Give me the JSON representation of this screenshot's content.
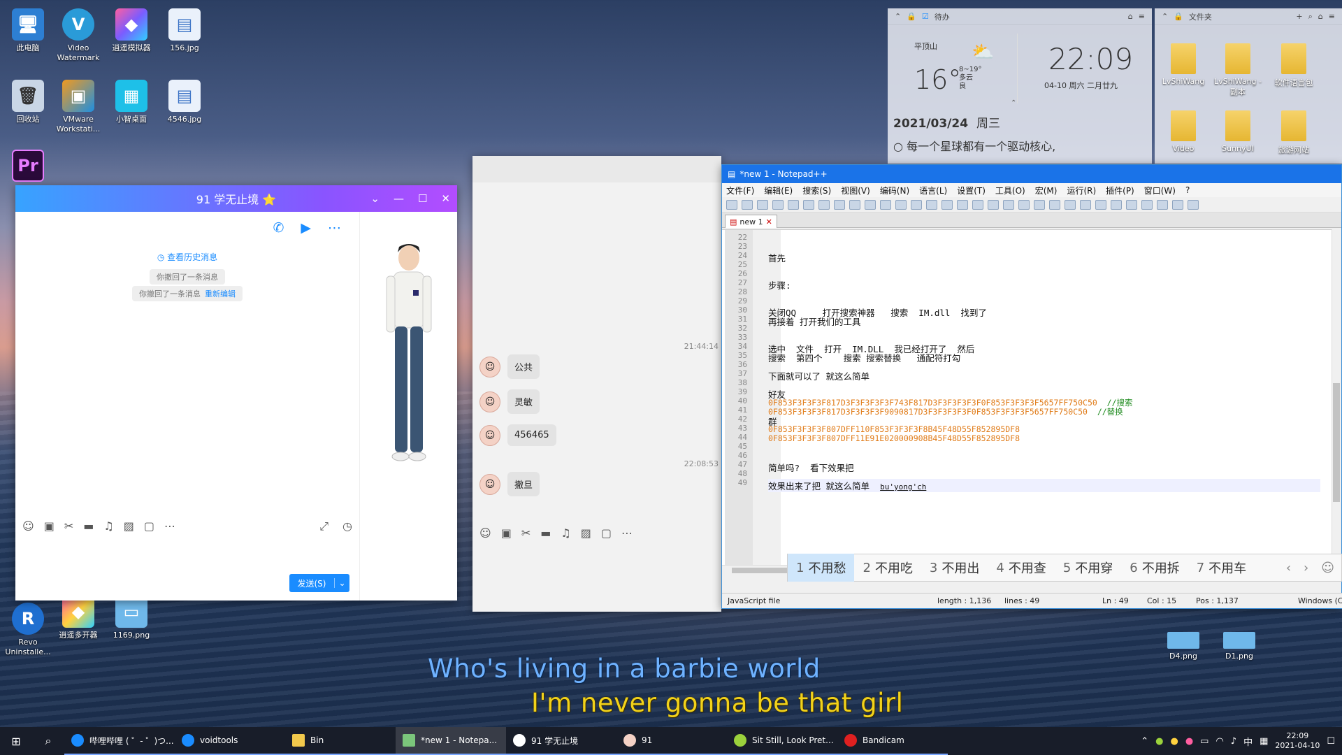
{
  "desktop": {
    "icons": [
      {
        "label": "此电脑",
        "glyph": "🖥"
      },
      {
        "label": "Video Watermark",
        "glyph": "V"
      },
      {
        "label": "逍遥模拟器",
        "glyph": "◆"
      },
      {
        "label": "156.jpg",
        "glyph": "▤"
      },
      {
        "label": "回收站",
        "glyph": "🗑"
      },
      {
        "label": "VMware Workstati...",
        "glyph": "▣"
      },
      {
        "label": "小智桌面",
        "glyph": "▦"
      },
      {
        "label": "4546.jpg",
        "glyph": "▤"
      },
      {
        "label": "Pr",
        "glyph": "Pr"
      },
      {
        "label": "Revo Uninstalle...",
        "glyph": "R"
      },
      {
        "label": "逍遥多开器",
        "glyph": "◆"
      },
      {
        "label": "1169.png",
        "glyph": "▭"
      }
    ],
    "lyrics": {
      "line1": "Who's living in a barbie world",
      "line2": "I'm never gonna be that girl"
    }
  },
  "widgets": {
    "todo": {
      "title": "待办"
    },
    "weather": {
      "location": "平顶山",
      "temp": "16°",
      "range": "8~19°",
      "condition": "多云",
      "aqi": "良"
    },
    "clock": {
      "time": "22:09",
      "date": "04-10 周六  二月廿九"
    },
    "quote": {
      "date": "2021/03/24",
      "weekday": "周三",
      "text": "每一个星球都有一个驱动核心,"
    },
    "files": {
      "title": "文件夹",
      "items": [
        "LvShiWang",
        "LvShiWang - 副本",
        "软件语言包",
        "Video",
        "SunnyUI",
        "旅游网站"
      ]
    },
    "desktop_files": [
      "D4.png",
      "D1.png"
    ]
  },
  "qq": {
    "title": "91 学无止境 ⭐",
    "history_link": "查看历史消息",
    "recall1": "你撤回了一条消息",
    "recall2": "你撤回了一条消息",
    "re_edit": "重新编辑",
    "send": "发送(S)"
  },
  "chat2": {
    "messages": [
      {
        "time": "21:44:14",
        "text": "公共"
      },
      {
        "text": "灵敏"
      },
      {
        "text": "456465"
      },
      {
        "time": "22:08:53",
        "text": "撤旦"
      }
    ]
  },
  "npp": {
    "title": "*new 1 - Notepad++",
    "menu": [
      "文件(F)",
      "编辑(E)",
      "搜索(S)",
      "视图(V)",
      "编码(N)",
      "语言(L)",
      "设置(T)",
      "工具(O)",
      "宏(M)",
      "运行(R)",
      "插件(P)",
      "窗口(W)",
      "?"
    ],
    "tab": "new 1",
    "line_numbers": [
      "22",
      "23",
      "24",
      "25",
      "26",
      "27",
      "28",
      "29",
      "30",
      "31",
      "32",
      "33",
      "34",
      "35",
      "36",
      "37",
      "38",
      "39",
      "40",
      "41",
      "42",
      "43",
      "44",
      "45",
      "46",
      "47",
      "48",
      "49"
    ],
    "lines": {
      "l24": "首先",
      "l27": "步骤:",
      "l30": "关闭QQ     打开搜索神器   搜索  IM.dll  找到了",
      "l31": "再接着 打开我们的工具",
      "l34": "选中  文件  打开  IM.DLL  我已经打开了  然后",
      "l35": "搜索  第四个    搜索 搜索替换   通配符打勾",
      "l37": "下面就可以了 就这么简单",
      "l39": "好友",
      "l40": "0F853F3F3F3F817D3F3F3F3F3F743F817D3F3F3F3F3F0F853F3F3F3F5657FF750C50",
      "l40c": "//搜索",
      "l41": "0F853F3F3F3F817D3F3F3F3F9090817D3F3F3F3F3F0F853F3F3F3F5657FF750C50",
      "l41c": "//替换",
      "l42": "群",
      "l43": "0F853F3F3F3F807DFF110F853F3F3F3F8B45F48D55F852895DF8",
      "l44": "0F853F3F3F3F807DFF11E91E020000908B45F48D55F852895DF8",
      "l47": "简单吗?  看下效果把",
      "l49": "效果出来了把 就这么简单",
      "l49ime": "bu'yong'ch"
    },
    "status": {
      "lang": "JavaScript file",
      "length": "length : 1,136",
      "lines": "lines : 49",
      "ln": "Ln : 49",
      "col": "Col : 15",
      "pos": "Pos : 1,137",
      "eol": "Windows (CR"
    }
  },
  "ime": {
    "candidates": [
      {
        "n": "1",
        "w": "不用愁"
      },
      {
        "n": "2",
        "w": "不用吃"
      },
      {
        "n": "3",
        "w": "不用出"
      },
      {
        "n": "4",
        "w": "不用查"
      },
      {
        "n": "5",
        "w": "不用穿"
      },
      {
        "n": "6",
        "w": "不用拆"
      },
      {
        "n": "7",
        "w": "不用车"
      }
    ]
  },
  "taskbar": {
    "items": [
      {
        "label": "哔哩哔哩 ( ゜- ゜)つ...",
        "color": "#1a8cff"
      },
      {
        "label": "voidtools",
        "color": "#1a8cff"
      },
      {
        "label": "Bin",
        "color": "#f2c94c"
      },
      {
        "label": "*new 1 - Notepa...",
        "color": "#7bc67b"
      },
      {
        "label": "91 学无止境",
        "color": "#ffffff"
      },
      {
        "label": "91",
        "color": "#f4d2c6"
      },
      {
        "label": "Sit Still, Look Pret...",
        "color": "#9bd23c"
      },
      {
        "label": "Bandicam",
        "color": "#e02020"
      }
    ],
    "time": "22:09",
    "date": "2021-04-10",
    "ime_lang": "中"
  }
}
